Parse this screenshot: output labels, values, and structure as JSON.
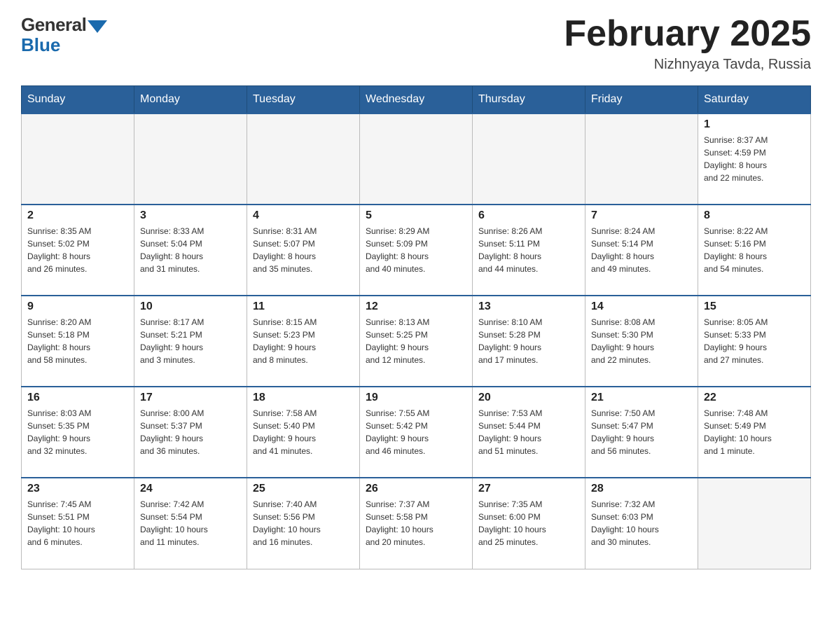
{
  "header": {
    "logo_general": "General",
    "logo_blue": "Blue",
    "month_title": "February 2025",
    "location": "Nizhnyaya Tavda, Russia"
  },
  "weekdays": [
    "Sunday",
    "Monday",
    "Tuesday",
    "Wednesday",
    "Thursday",
    "Friday",
    "Saturday"
  ],
  "weeks": [
    [
      {
        "day": "",
        "info": ""
      },
      {
        "day": "",
        "info": ""
      },
      {
        "day": "",
        "info": ""
      },
      {
        "day": "",
        "info": ""
      },
      {
        "day": "",
        "info": ""
      },
      {
        "day": "",
        "info": ""
      },
      {
        "day": "1",
        "info": "Sunrise: 8:37 AM\nSunset: 4:59 PM\nDaylight: 8 hours\nand 22 minutes."
      }
    ],
    [
      {
        "day": "2",
        "info": "Sunrise: 8:35 AM\nSunset: 5:02 PM\nDaylight: 8 hours\nand 26 minutes."
      },
      {
        "day": "3",
        "info": "Sunrise: 8:33 AM\nSunset: 5:04 PM\nDaylight: 8 hours\nand 31 minutes."
      },
      {
        "day": "4",
        "info": "Sunrise: 8:31 AM\nSunset: 5:07 PM\nDaylight: 8 hours\nand 35 minutes."
      },
      {
        "day": "5",
        "info": "Sunrise: 8:29 AM\nSunset: 5:09 PM\nDaylight: 8 hours\nand 40 minutes."
      },
      {
        "day": "6",
        "info": "Sunrise: 8:26 AM\nSunset: 5:11 PM\nDaylight: 8 hours\nand 44 minutes."
      },
      {
        "day": "7",
        "info": "Sunrise: 8:24 AM\nSunset: 5:14 PM\nDaylight: 8 hours\nand 49 minutes."
      },
      {
        "day": "8",
        "info": "Sunrise: 8:22 AM\nSunset: 5:16 PM\nDaylight: 8 hours\nand 54 minutes."
      }
    ],
    [
      {
        "day": "9",
        "info": "Sunrise: 8:20 AM\nSunset: 5:18 PM\nDaylight: 8 hours\nand 58 minutes."
      },
      {
        "day": "10",
        "info": "Sunrise: 8:17 AM\nSunset: 5:21 PM\nDaylight: 9 hours\nand 3 minutes."
      },
      {
        "day": "11",
        "info": "Sunrise: 8:15 AM\nSunset: 5:23 PM\nDaylight: 9 hours\nand 8 minutes."
      },
      {
        "day": "12",
        "info": "Sunrise: 8:13 AM\nSunset: 5:25 PM\nDaylight: 9 hours\nand 12 minutes."
      },
      {
        "day": "13",
        "info": "Sunrise: 8:10 AM\nSunset: 5:28 PM\nDaylight: 9 hours\nand 17 minutes."
      },
      {
        "day": "14",
        "info": "Sunrise: 8:08 AM\nSunset: 5:30 PM\nDaylight: 9 hours\nand 22 minutes."
      },
      {
        "day": "15",
        "info": "Sunrise: 8:05 AM\nSunset: 5:33 PM\nDaylight: 9 hours\nand 27 minutes."
      }
    ],
    [
      {
        "day": "16",
        "info": "Sunrise: 8:03 AM\nSunset: 5:35 PM\nDaylight: 9 hours\nand 32 minutes."
      },
      {
        "day": "17",
        "info": "Sunrise: 8:00 AM\nSunset: 5:37 PM\nDaylight: 9 hours\nand 36 minutes."
      },
      {
        "day": "18",
        "info": "Sunrise: 7:58 AM\nSunset: 5:40 PM\nDaylight: 9 hours\nand 41 minutes."
      },
      {
        "day": "19",
        "info": "Sunrise: 7:55 AM\nSunset: 5:42 PM\nDaylight: 9 hours\nand 46 minutes."
      },
      {
        "day": "20",
        "info": "Sunrise: 7:53 AM\nSunset: 5:44 PM\nDaylight: 9 hours\nand 51 minutes."
      },
      {
        "day": "21",
        "info": "Sunrise: 7:50 AM\nSunset: 5:47 PM\nDaylight: 9 hours\nand 56 minutes."
      },
      {
        "day": "22",
        "info": "Sunrise: 7:48 AM\nSunset: 5:49 PM\nDaylight: 10 hours\nand 1 minute."
      }
    ],
    [
      {
        "day": "23",
        "info": "Sunrise: 7:45 AM\nSunset: 5:51 PM\nDaylight: 10 hours\nand 6 minutes."
      },
      {
        "day": "24",
        "info": "Sunrise: 7:42 AM\nSunset: 5:54 PM\nDaylight: 10 hours\nand 11 minutes."
      },
      {
        "day": "25",
        "info": "Sunrise: 7:40 AM\nSunset: 5:56 PM\nDaylight: 10 hours\nand 16 minutes."
      },
      {
        "day": "26",
        "info": "Sunrise: 7:37 AM\nSunset: 5:58 PM\nDaylight: 10 hours\nand 20 minutes."
      },
      {
        "day": "27",
        "info": "Sunrise: 7:35 AM\nSunset: 6:00 PM\nDaylight: 10 hours\nand 25 minutes."
      },
      {
        "day": "28",
        "info": "Sunrise: 7:32 AM\nSunset: 6:03 PM\nDaylight: 10 hours\nand 30 minutes."
      },
      {
        "day": "",
        "info": ""
      }
    ]
  ]
}
